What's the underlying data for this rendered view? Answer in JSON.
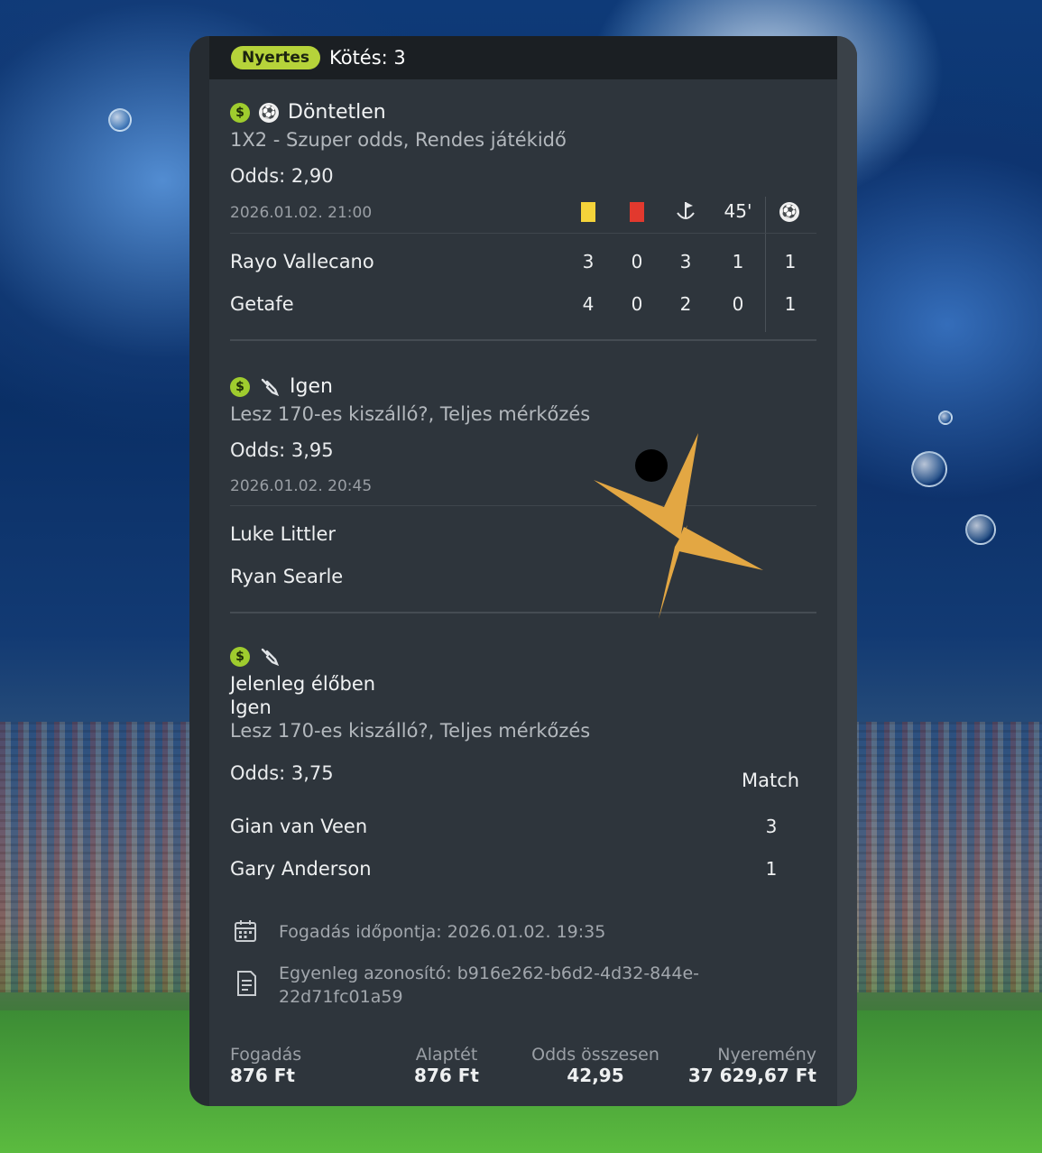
{
  "header": {
    "status_badge": "Nyertes",
    "bet_count_label": "Kötés: 3"
  },
  "bets": [
    {
      "selection": "Döntetlen",
      "market": "1X2 - Szuper odds, Rendes játékidő",
      "odds": "Odds: 2,90",
      "datetime": "2026.01.02.  21:00",
      "stats_header": {
        "yellow_card_icon": "yellow-card-icon",
        "red_card_icon": "red-card-icon",
        "corner_icon": "corner-flag-icon",
        "period": "45'",
        "goals_icon": "soccer-ball-icon"
      },
      "teams": [
        {
          "name": "Rayo Vallecano",
          "yellow": "3",
          "red": "0",
          "corners": "3",
          "period": "1",
          "goals": "1"
        },
        {
          "name": "Getafe",
          "yellow": "4",
          "red": "0",
          "corners": "2",
          "period": "0",
          "goals": "1"
        }
      ]
    },
    {
      "selection": "Igen",
      "market": "Lesz 170-es kiszálló?, Teljes mérkőzés",
      "odds": "Odds: 3,95",
      "datetime": "2026.01.02.  20:45",
      "players": [
        "Luke Littler",
        "Ryan Searle"
      ]
    },
    {
      "status": "Jelenleg élőben",
      "selection": "Igen",
      "market": "Lesz 170-es kiszálló?, Teljes mérkőzés",
      "odds": "Odds: 3,75",
      "score_header": "Match",
      "players": [
        {
          "name": "Gian van Veen",
          "score": "3"
        },
        {
          "name": "Gary Anderson",
          "score": "1"
        }
      ]
    }
  ],
  "meta": {
    "placed_label": "Fogadás időpontja:  2026.01.02.  19:35",
    "balance_id_line1": "Egyenleg azonosító: b916e262-b6d2-4d32-844e-",
    "balance_id_line2": "22d71fc01a59"
  },
  "summary": [
    {
      "label": "Fogadás",
      "value": "876 Ft"
    },
    {
      "label": "Alaptét",
      "value": "876 Ft"
    },
    {
      "label": "Odds összesen",
      "value": "42,95"
    },
    {
      "label": "Nyeremény",
      "value": "37 629,67 Ft"
    }
  ],
  "colors": {
    "card_bg": "#2e353c",
    "badge": "#b6d33a",
    "logo": "#e3a743"
  }
}
